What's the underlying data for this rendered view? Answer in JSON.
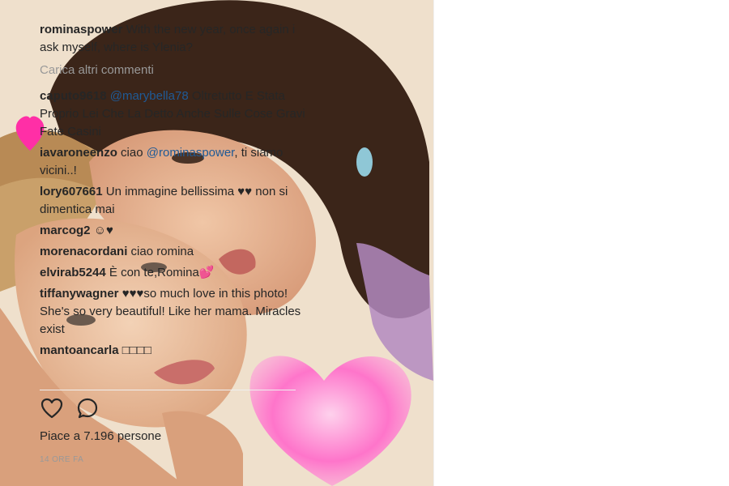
{
  "post": {
    "caption": {
      "user": "rominaspower",
      "text": "With the new year, once again i ask myself, where is Ylenia?"
    },
    "load_more_label": "Carica altri commenti",
    "comments": [
      {
        "user": "caputo9618",
        "mention": "@marybella78",
        "text": "Oltretutto E Stata Proprio Lei Che La Detto Anche Sulle Cose Gravi Fate Casini"
      },
      {
        "user": "iavaroneenzo",
        "pre": "ciao",
        "mention": "@rominaspower",
        "text": ", ti siamo vicini..!"
      },
      {
        "user": "lory607661",
        "text": "Un immagine bellissima ♥♥ non si dimentica mai"
      },
      {
        "user": "marcog2",
        "text": "☺♥"
      },
      {
        "user": "morenacordani",
        "text": "ciao romina"
      },
      {
        "user": "elvirab5244",
        "text": "È con te,Romina💕"
      },
      {
        "user": "tiffanywagner",
        "text": "♥♥♥so much love in this photo! She's so very beautiful! Like her mama. Miracles exist"
      },
      {
        "user": "mantoancarla",
        "text": "□□□□"
      }
    ],
    "likes_label": "Piace a 7.196 persone",
    "timestamp": "14 ORE FA",
    "icons": {
      "like": "heart-outline-icon",
      "comment": "comment-bubble-icon"
    }
  },
  "colors": {
    "mention": "#1f5a96",
    "muted": "#999999",
    "text": "#262626",
    "heart_pink": "#ff3fb0"
  }
}
